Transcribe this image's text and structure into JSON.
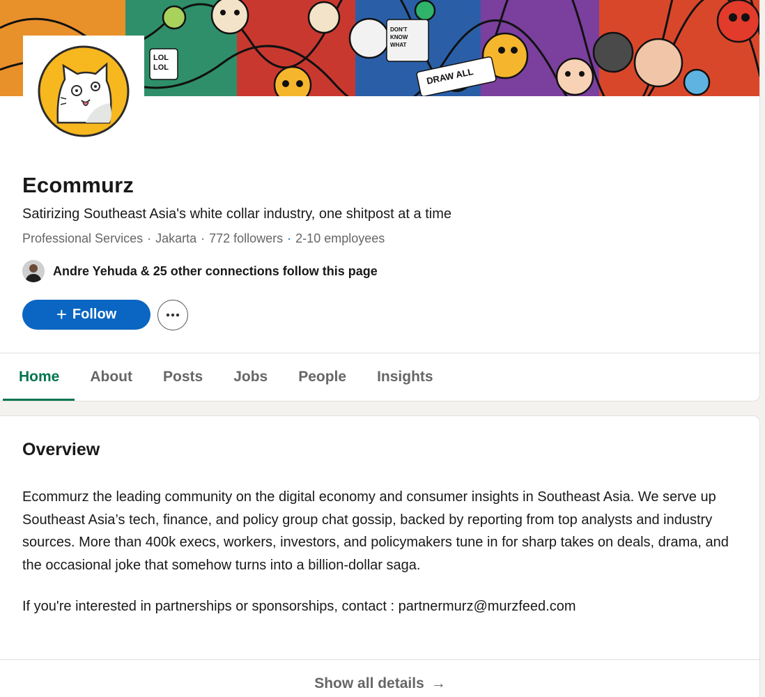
{
  "company": {
    "name": "Ecommurz",
    "tagline": "Satirizing Southeast Asia's white collar industry, one shitpost at a time",
    "industry": "Professional Services",
    "location": "Jakarta",
    "followers": "772 followers",
    "employees": "2-10 employees"
  },
  "connections": {
    "text": "Andre Yehuda & 25 other connections follow this page"
  },
  "actions": {
    "follow_label": "Follow",
    "follow_icon": "+",
    "more_icon": "ellipsis-icon"
  },
  "tabs": [
    {
      "label": "Home",
      "active": true
    },
    {
      "label": "About",
      "active": false
    },
    {
      "label": "Posts",
      "active": false
    },
    {
      "label": "Jobs",
      "active": false
    },
    {
      "label": "People",
      "active": false
    },
    {
      "label": "Insights",
      "active": false
    }
  ],
  "overview": {
    "title": "Overview",
    "body": "Ecommurz the leading community on the digital economy and consumer insights in Southeast Asia. We serve up Southeast Asia’s tech, finance, and policy group chat gossip, backed by reporting from top analysts and industry sources. More than 400k execs, workers, investors, and policymakers tune in for sharp takes on deals, drama, and the occasional joke that somehow turns into a billion-dollar saga.",
    "contact": "If you're interested in partnerships or sponsorships, contact : partnermurz@murzfeed.com",
    "show_all_label": "Show all details",
    "show_all_icon": "→"
  },
  "colors": {
    "brand_blue": "#0a66c2",
    "active_tab_green": "#01754f",
    "logo_yellow": "#f7b71e"
  }
}
